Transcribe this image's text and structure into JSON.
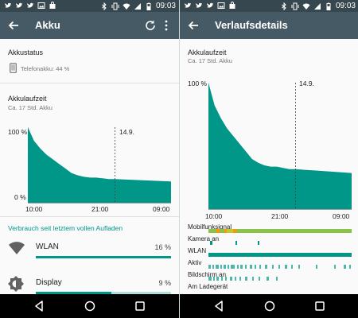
{
  "statusbar": {
    "time_left": "09:03",
    "time_right": "09:03"
  },
  "left": {
    "title": "Akku",
    "status_heading": "Akkustatus",
    "phone_battery": "Telefonakku: 44 %",
    "runtime_heading": "Akkulaufzeit",
    "runtime_sub": "Ca. 17 Std. Akku",
    "chart_y_top": "100 %",
    "chart_y_bottom": "0 %",
    "chart_date_marker": "14.9.",
    "chart_x_ticks": [
      "10:00",
      "21:00",
      "09:00"
    ],
    "usage_heading": "Verbrauch seit letztem vollen Aufladen",
    "usage": [
      {
        "label": "WLAN",
        "percent": "16 %",
        "fraction": 1.0
      },
      {
        "label": "Display",
        "percent": "9 %",
        "fraction": 0.56
      }
    ]
  },
  "right": {
    "title": "Verlaufsdetails",
    "runtime_heading": "Akkulaufzeit",
    "runtime_sub": "Ca. 17 Std. Akku",
    "chart_y_top": "100 %",
    "chart_date_marker": "14.9.",
    "chart_x_ticks": [
      "10:00",
      "21:00",
      "09:00"
    ],
    "events": [
      {
        "label": "Mobilfunksignal"
      },
      {
        "label": "Kamera an"
      },
      {
        "label": "WLAN"
      },
      {
        "label": "Aktiv"
      },
      {
        "label": "Bildschirm an"
      },
      {
        "label": "Am Ladegerät"
      }
    ]
  },
  "chart_data": {
    "type": "area",
    "x": [
      "10:00",
      "11:00",
      "12:00",
      "13:00",
      "14:00",
      "15:00",
      "16:00",
      "17:00",
      "18:00",
      "19:00",
      "20:00",
      "21:00",
      "22:00",
      "23:00",
      "00:00",
      "03:00",
      "06:00",
      "09:00"
    ],
    "series": [
      {
        "values": [
          100,
          82,
          72,
          64,
          58,
          52,
          46,
          40,
          37,
          35,
          34,
          34,
          33,
          32,
          32,
          31,
          30,
          29
        ]
      }
    ],
    "xlabel": "",
    "ylabel": "",
    "ylim": [
      0,
      100
    ]
  },
  "colors": {
    "accent": "#009688",
    "appbar": "#455a64",
    "statusbar": "#37474f",
    "track": "#b2dfdb",
    "signal_good": "#8bc34a",
    "signal_warn": "#ff9800"
  }
}
